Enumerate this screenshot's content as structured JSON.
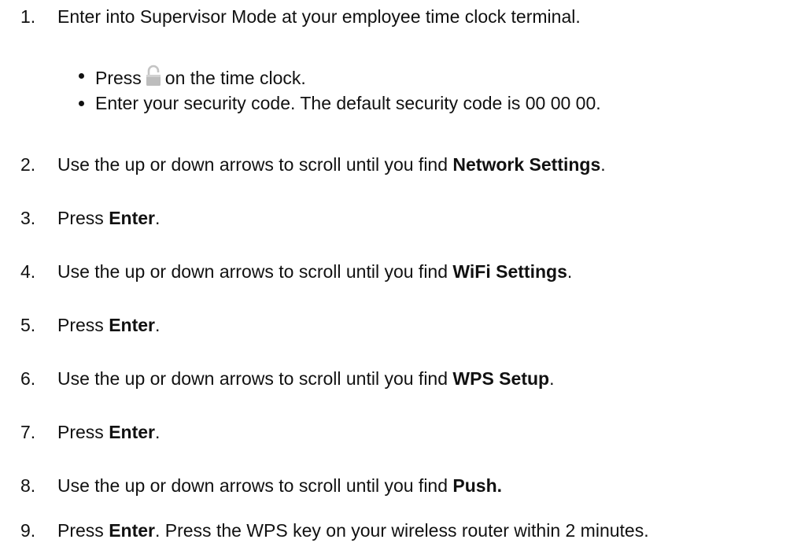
{
  "steps": [
    {
      "number": "1.",
      "text": "Enter into Supervisor Mode at your employee time clock terminal.",
      "substeps": [
        {
          "pre": "Press",
          "icon": "lock-icon",
          "post": "on the time clock."
        },
        {
          "text": "Enter your security code. The default security code is 00 00 00."
        }
      ]
    },
    {
      "number": "2.",
      "pre": "Use the up or down arrows to scroll until you find ",
      "bold": "Network Settings",
      "post": "."
    },
    {
      "number": "3.",
      "pre": "Press ",
      "bold": "Enter",
      "post": "."
    },
    {
      "number": "4.",
      "pre": "Use the up or down arrows to scroll until you find ",
      "bold": "WiFi Settings",
      "post": "."
    },
    {
      "number": "5.",
      "pre": "Press ",
      "bold": "Enter",
      "post": "."
    },
    {
      "number": "6.",
      "pre": "Use the up or down arrows to scroll until you find ",
      "bold": "WPS Setup",
      "post": "."
    },
    {
      "number": "7.",
      "pre": "Press ",
      "bold": "Enter",
      "post": "."
    },
    {
      "number": "8.",
      "pre": "Use the up or down arrows to scroll until you find ",
      "bold": "Push.",
      "post": ""
    },
    {
      "number": "9.",
      "pre": "Press ",
      "bold": "Enter",
      "post": ". Press the WPS key on your wireless router within 2 minutes."
    }
  ]
}
